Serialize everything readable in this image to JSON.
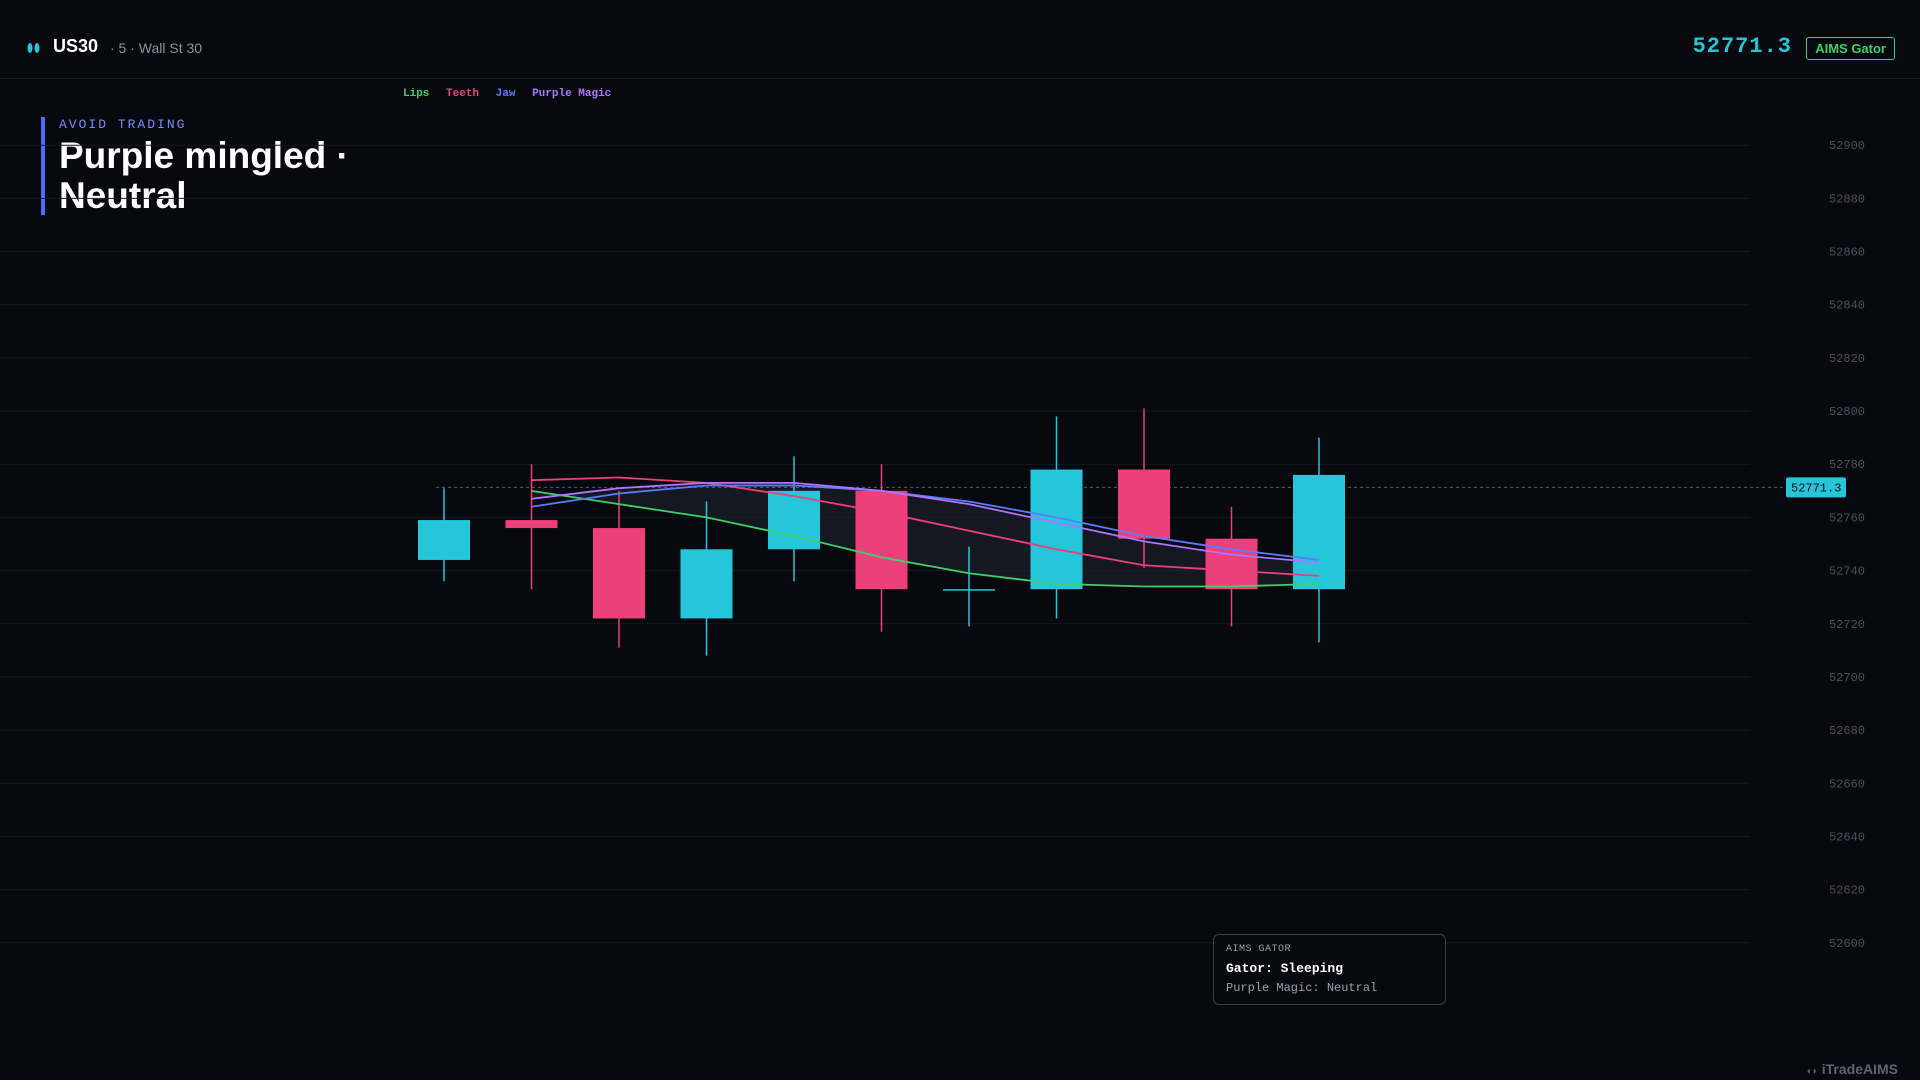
{
  "header": {
    "symbol": "US30",
    "subtitle": "· 5 · Wall St 30",
    "price": "52771.3",
    "badge": "AIMS Gator"
  },
  "legend": [
    {
      "label": "Lips",
      "color": "#3ecf6a"
    },
    {
      "label": "Teeth",
      "color": "#ec407a"
    },
    {
      "label": "Jaw",
      "color": "#5b7cff"
    },
    {
      "label": "Purple Magic",
      "color": "#b073ff"
    }
  ],
  "status": {
    "kicker": "AVOID TRADING",
    "title": "Purple mingled · Neutral"
  },
  "tooltip": {
    "kicker": "AIMS GATOR",
    "gator": "Gator: Sleeping",
    "purple_magic": "Purple Magic: Neutral"
  },
  "watermark": "iTradeAIMS",
  "colors": {
    "up": "#26c6da",
    "down": "#ec407a",
    "background": "#07090e"
  },
  "chart_data": {
    "type": "candlestick",
    "y_ticks": [
      52900,
      52880,
      52860,
      52840,
      52820,
      52800,
      52780,
      52760,
      52740,
      52720,
      52700,
      52680,
      52660,
      52640,
      52620,
      52600
    ],
    "ylim": [
      52586,
      52914
    ],
    "last_price": 52771.3,
    "last_price_label": "52771.3",
    "grid": true,
    "candles": [
      {
        "open": 52744,
        "high": 52771,
        "low": 52736,
        "close": 52759
      },
      {
        "open": 52759,
        "high": 52780,
        "low": 52733,
        "close": 52756
      },
      {
        "open": 52756,
        "high": 52770,
        "low": 52711,
        "close": 52722
      },
      {
        "open": 52722,
        "high": 52766,
        "low": 52708,
        "close": 52748
      },
      {
        "open": 52748,
        "high": 52783,
        "low": 52736,
        "close": 52770
      },
      {
        "open": 52770,
        "high": 52780,
        "low": 52717,
        "close": 52733
      },
      {
        "open": 52733,
        "high": 52749,
        "low": 52719,
        "close": 52733
      },
      {
        "open": 52733,
        "high": 52798,
        "low": 52722,
        "close": 52778
      },
      {
        "open": 52778,
        "high": 52801,
        "low": 52741,
        "close": 52752
      },
      {
        "open": 52752,
        "high": 52764,
        "low": 52719,
        "close": 52733
      },
      {
        "open": 52733,
        "high": 52790,
        "low": 52713,
        "close": 52776
      }
    ],
    "series": [
      {
        "name": "Lips",
        "color": "#3ecf6a",
        "start": 1,
        "values": [
          52770,
          52765,
          52760,
          52753,
          52745,
          52739,
          52735,
          52734,
          52734,
          52735
        ]
      },
      {
        "name": "Teeth",
        "color": "#ec407a",
        "start": 1,
        "values": [
          52774,
          52775,
          52773,
          52768,
          52762,
          52755,
          52748,
          52742,
          52740,
          52738
        ]
      },
      {
        "name": "Jaw",
        "color": "#5b7cff",
        "start": 1,
        "values": [
          52764,
          52769,
          52772,
          52772,
          52770,
          52766,
          52760,
          52753,
          52748,
          52744
        ]
      },
      {
        "name": "Purple Magic",
        "color": "#b073ff",
        "start": 1,
        "values": [
          52767,
          52771,
          52773,
          52773,
          52770,
          52765,
          52758,
          52751,
          52746,
          52743
        ]
      }
    ]
  }
}
